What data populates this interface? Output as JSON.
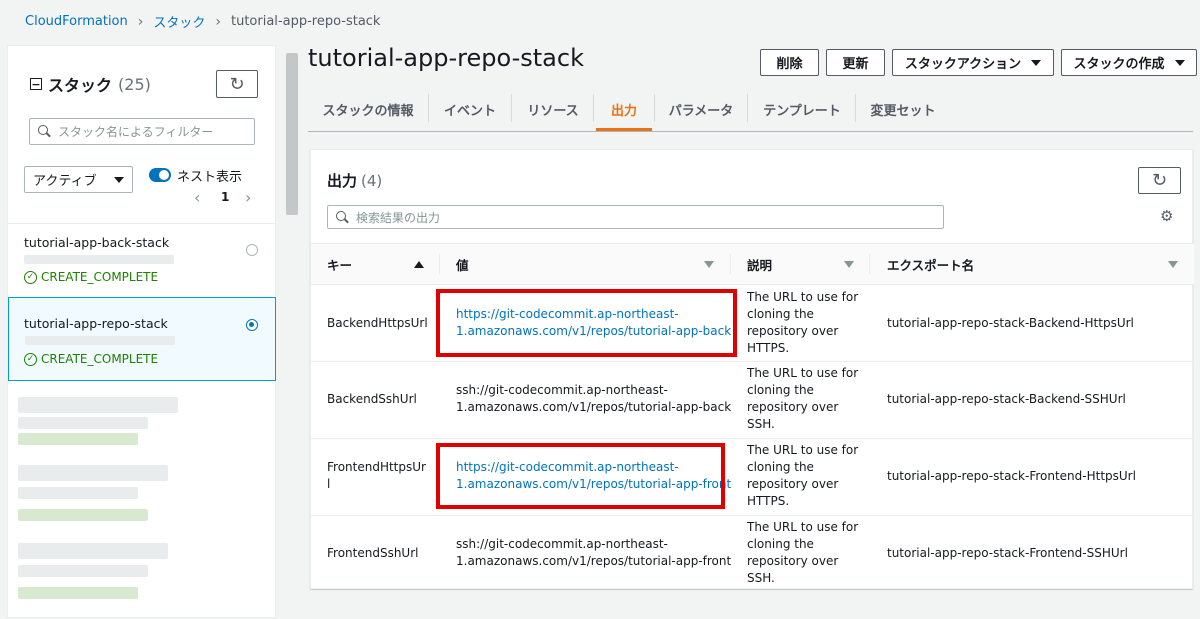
{
  "breadcrumb": {
    "root": "CloudFormation",
    "stacks": "スタック",
    "current": "tutorial-app-repo-stack"
  },
  "sidebar": {
    "title": "スタック",
    "count": "(25)",
    "search_placeholder": "スタック名によるフィルター",
    "filter_value": "アクティブ",
    "nested_label": "ネスト表示",
    "page": "1",
    "stacks": [
      {
        "name": "tutorial-app-back-stack",
        "status": "CREATE_COMPLETE",
        "selected": false
      },
      {
        "name": "tutorial-app-repo-stack",
        "status": "CREATE_COMPLETE",
        "selected": true
      }
    ]
  },
  "header": {
    "title": "tutorial-app-repo-stack",
    "delete_label": "削除",
    "update_label": "更新",
    "stack_actions_label": "スタックアクション",
    "create_stack_label": "スタックの作成"
  },
  "tabs": [
    {
      "label": "スタックの情報"
    },
    {
      "label": "イベント"
    },
    {
      "label": "リソース"
    },
    {
      "label": "出力",
      "active": true
    },
    {
      "label": "パラメータ"
    },
    {
      "label": "テンプレート"
    },
    {
      "label": "変更セット"
    }
  ],
  "outputs": {
    "title": "出力",
    "count": "(4)",
    "search_placeholder": "検索結果の出力",
    "columns": {
      "key": "キー",
      "value": "値",
      "description": "説明",
      "export": "エクスポート名"
    },
    "rows": [
      {
        "key": "BackendHttpsUrl",
        "value_line1": "https://git-codecommit.ap-northeast-",
        "value_line2": "1.amazonaws.com/v1/repos/tutorial-app-back",
        "description_lines": [
          "The URL to use for",
          "cloning the",
          "repository over",
          "HTTPS."
        ],
        "export": "tutorial-app-repo-stack-Backend-HttpsUrl",
        "link": true,
        "highlighted": true
      },
      {
        "key": "BackendSshUrl",
        "value_line1": "ssh://git-codecommit.ap-northeast-",
        "value_line2": "1.amazonaws.com/v1/repos/tutorial-app-back",
        "description_lines": [
          "The URL to use for",
          "cloning the",
          "repository over",
          "SSH."
        ],
        "export": "tutorial-app-repo-stack-Backend-SSHUrl",
        "link": false,
        "highlighted": false
      },
      {
        "key_line1": "FrontendHttpsUr",
        "key_line2": "l",
        "value_line1": "https://git-codecommit.ap-northeast-",
        "value_line2": "1.amazonaws.com/v1/repos/tutorial-app-front",
        "description_lines": [
          "The URL to use for",
          "cloning the",
          "repository over",
          "HTTPS."
        ],
        "export": "tutorial-app-repo-stack-Frontend-HttpsUrl",
        "link": true,
        "highlighted": true
      },
      {
        "key": "FrontendSshUrl",
        "value_line1": "ssh://git-codecommit.ap-northeast-",
        "value_line2": "1.amazonaws.com/v1/repos/tutorial-app-front",
        "description_lines": [
          "The URL to use for",
          "cloning the",
          "repository over",
          "SSH."
        ],
        "export": "tutorial-app-repo-stack-Frontend-SSHUrl",
        "link": false,
        "highlighted": false
      }
    ]
  },
  "colors": {
    "link": "#0073bb",
    "accent": "#ec7211",
    "success": "#1d8102",
    "highlight": "#e00000"
  },
  "icons": [
    "chevron-right-icon",
    "collapse-icon",
    "refresh-icon",
    "search-icon",
    "caret-down-icon",
    "chevron-left-icon",
    "check-circle-icon",
    "settings-gear-icon",
    "sort-ascending-icon",
    "sort-descending-icon"
  ]
}
